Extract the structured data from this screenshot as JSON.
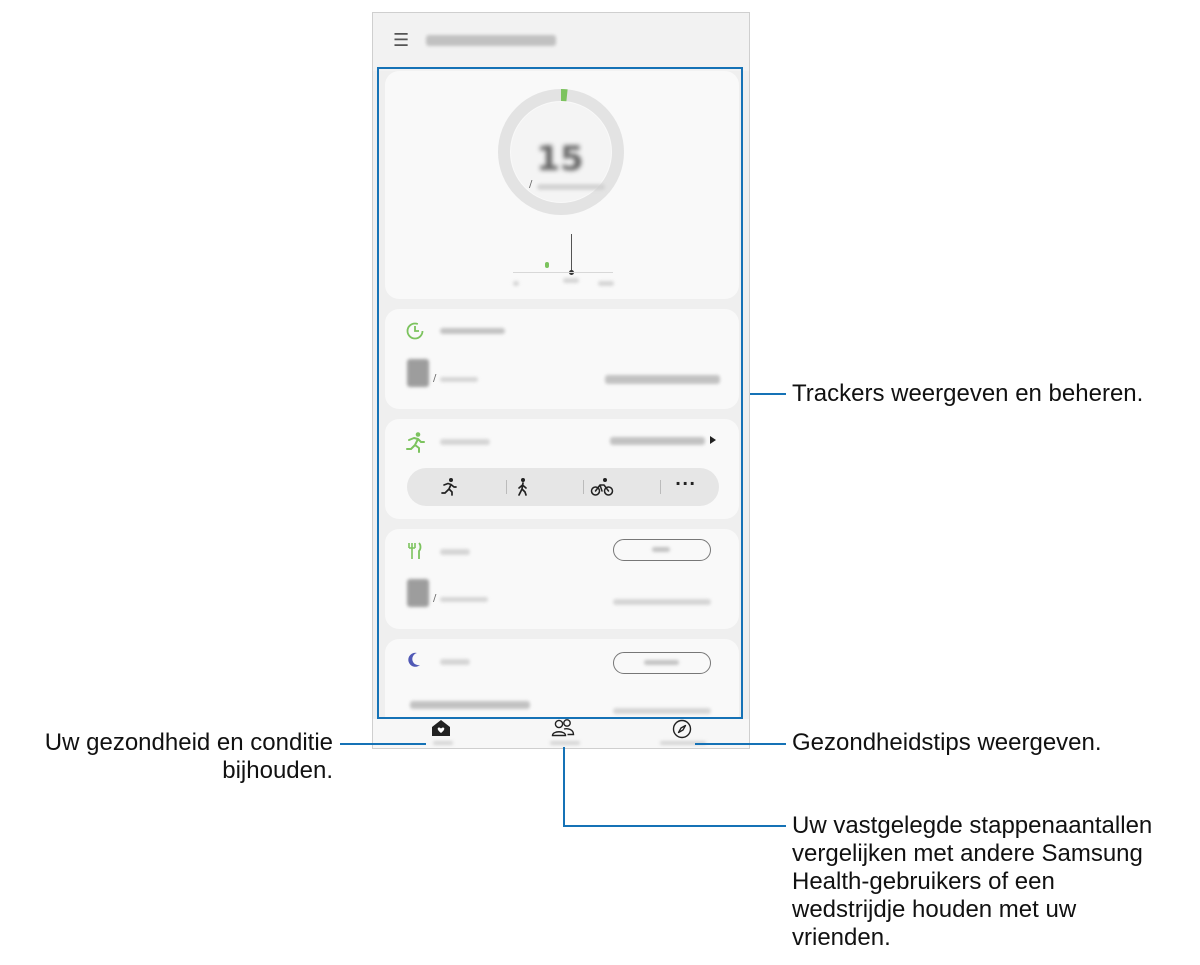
{
  "annotations": {
    "trackers": "Trackers weergeven en beheren.",
    "home_line1": "Uw gezondheid en conditie",
    "home_line2": "bijhouden.",
    "tips": "Gezondheidstips weergeven.",
    "together_line1": "Uw vastgelegde stappenaantallen",
    "together_line2": "vergelijken met andere Samsung",
    "together_line3": "Health-gebruikers of een",
    "together_line4": "wedstrijdje houden met uw",
    "together_line5": "vrienden."
  },
  "steps": {
    "count": "15",
    "separator": "/"
  },
  "activity": {
    "separator": "/"
  },
  "food": {
    "separator": "/"
  },
  "colors": {
    "accent_green": "#7cc35e",
    "callout_blue": "#1572b6",
    "sleep_purple": "#5059b6"
  },
  "icons": {
    "menu": "menu-icon",
    "home": "home-heart-icon",
    "together": "people-icon",
    "discover": "compass-icon"
  }
}
